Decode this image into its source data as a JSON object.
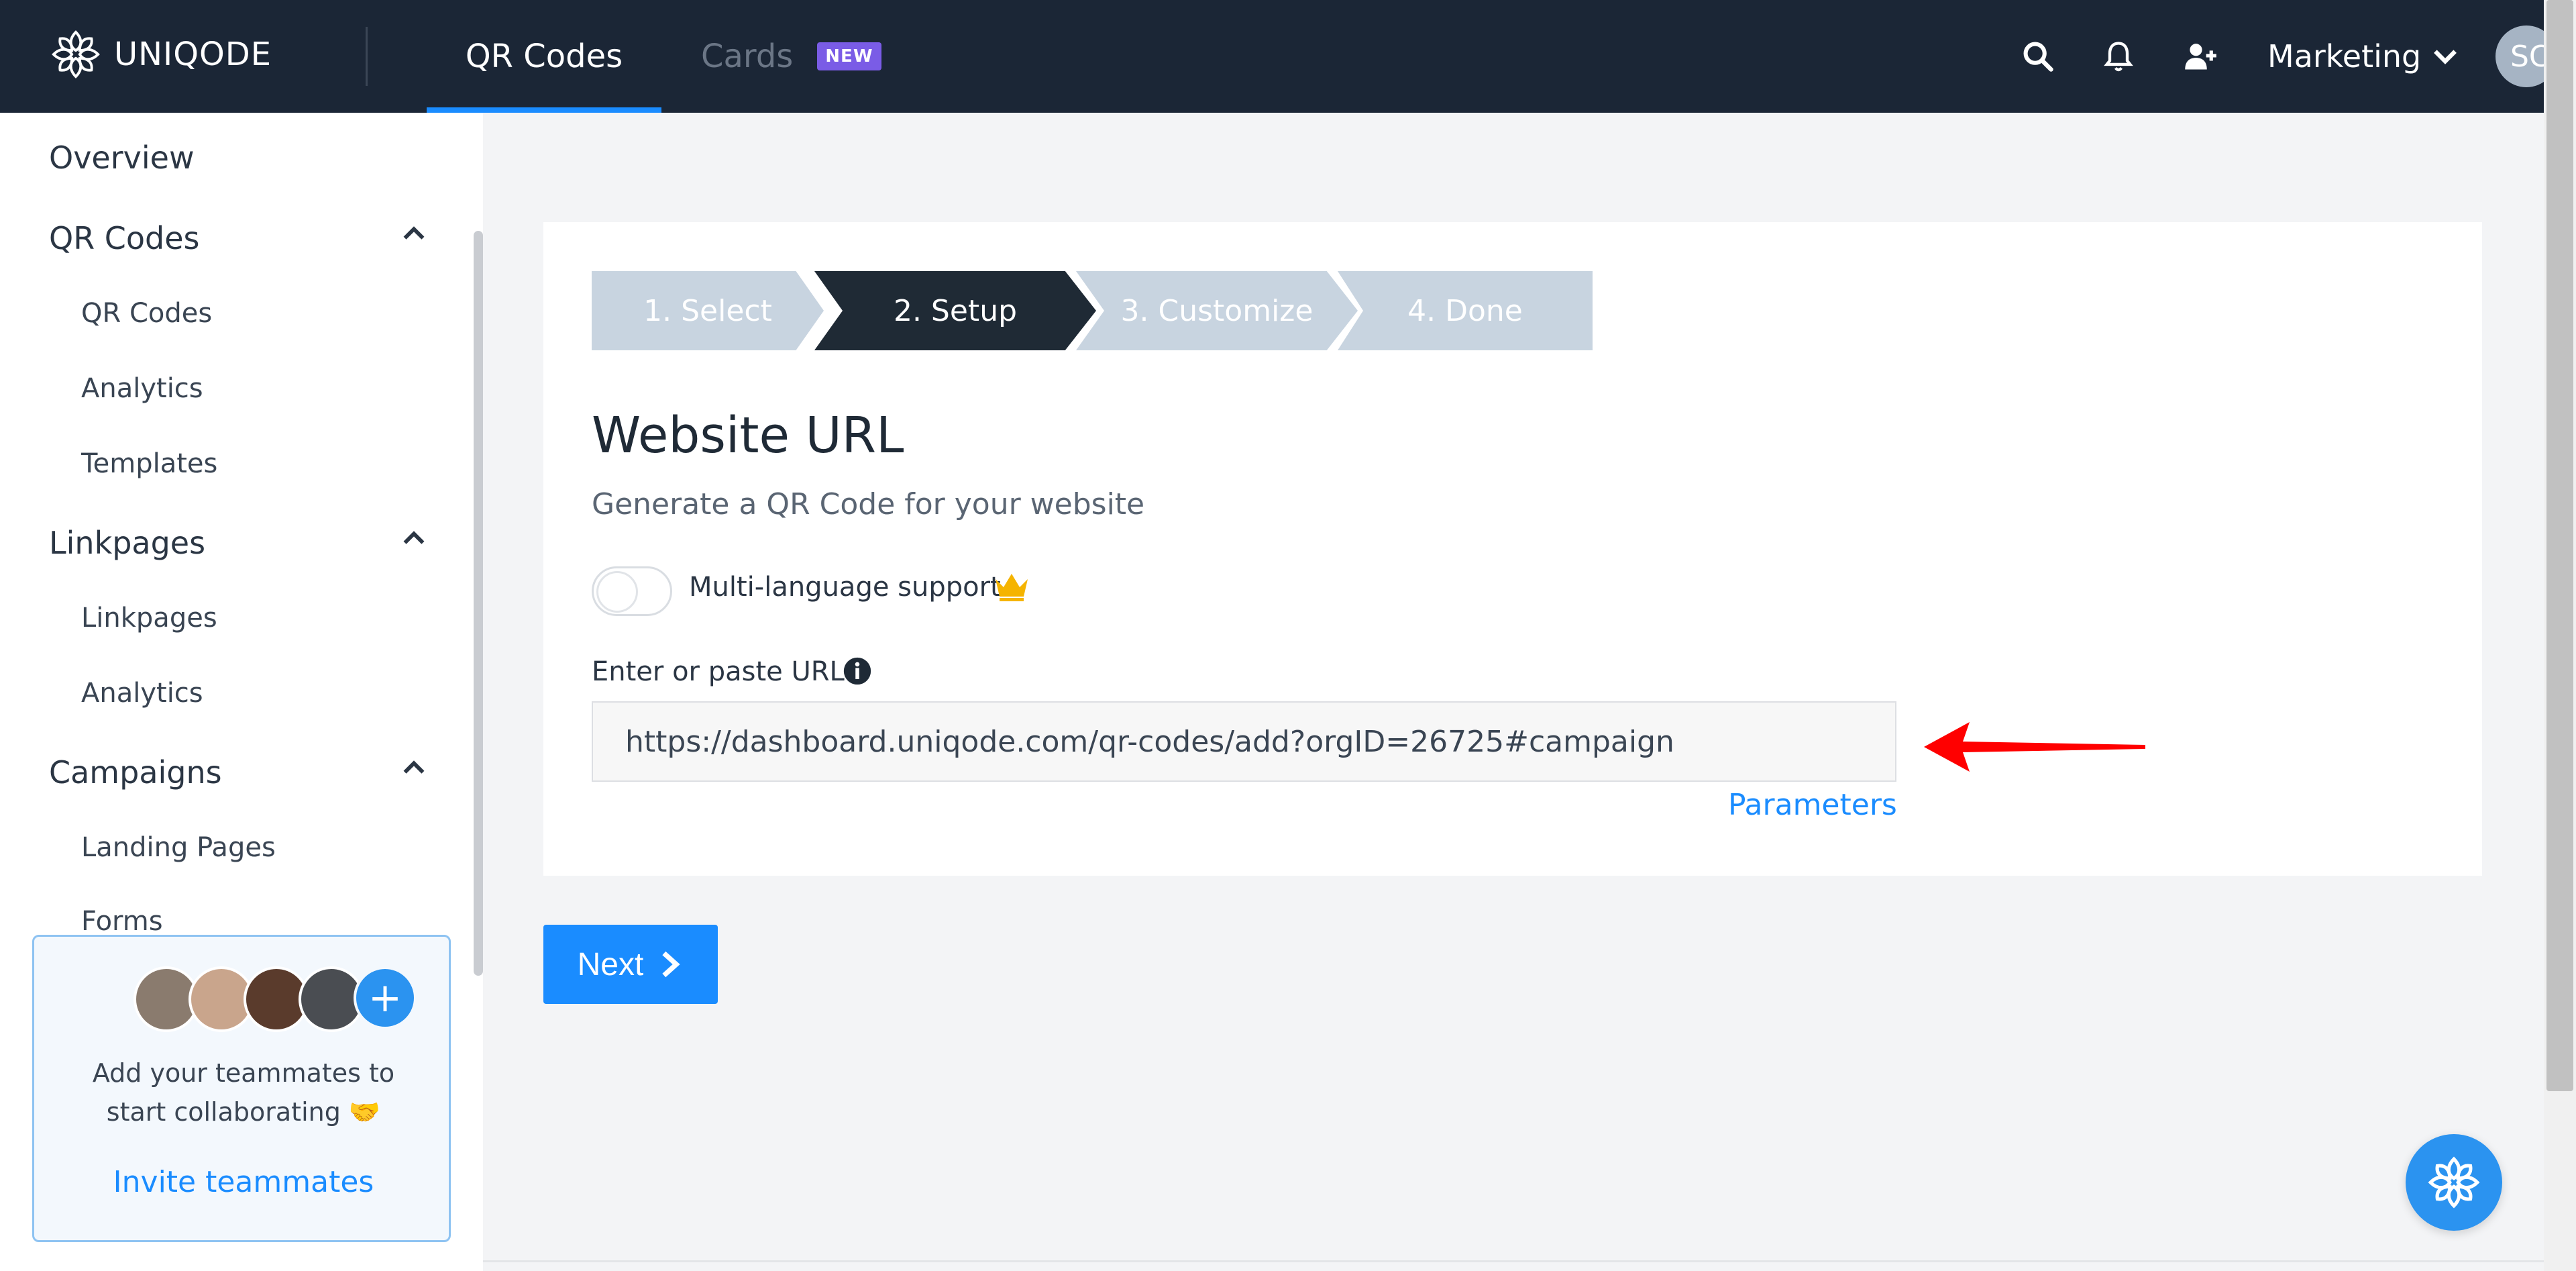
{
  "header": {
    "logo_text": "UNIQODE",
    "tabs": [
      {
        "label": "QR Codes",
        "active": true
      },
      {
        "label": "Cards",
        "badge": "NEW"
      }
    ],
    "org_name": "Marketing",
    "avatar_initials": "SC",
    "icons": [
      "search-icon",
      "bell-icon",
      "add-user-icon",
      "chevron-down-icon"
    ]
  },
  "sidebar": {
    "overview": "Overview",
    "sections": [
      {
        "label": "QR Codes",
        "items": [
          "QR Codes",
          "Analytics",
          "Templates"
        ]
      },
      {
        "label": "Linkpages",
        "items": [
          "Linkpages",
          "Analytics"
        ]
      },
      {
        "label": "Campaigns",
        "items": [
          "Landing Pages",
          "Forms"
        ]
      }
    ],
    "team_card": {
      "line1": "Add your teammates to",
      "line2": "start collaborating 🤝",
      "link": "Invite teammates",
      "plus": "+"
    }
  },
  "stepper": [
    "1. Select",
    "2. Setup",
    "3. Customize",
    "4. Done"
  ],
  "main": {
    "title": "Website URL",
    "subtitle": "Generate a QR Code for your website",
    "toggle_label": "Multi-language support",
    "url_label": "Enter or paste URL",
    "url_value": "https://dashboard.uniqode.com/qr-codes/add?orgID=26725#campaign",
    "parameters_link": "Parameters",
    "next_button": "Next"
  },
  "colors": {
    "header_bg": "#1b2636",
    "accent": "#1a8cff",
    "badge": "#7a5ce6",
    "annotation_arrow": "#ff0000",
    "crown": "#f5b400"
  }
}
